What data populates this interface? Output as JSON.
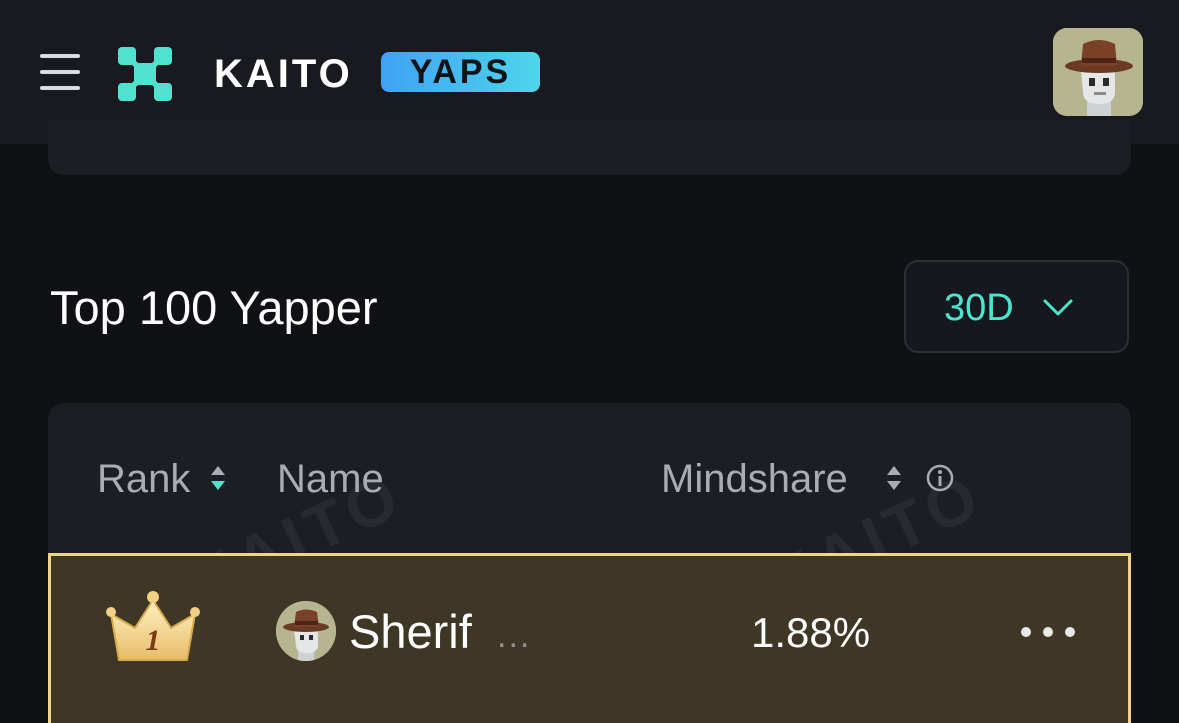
{
  "header": {
    "menu_icon": "hamburger-menu-icon",
    "logo_icon": "kaito-x-logo-icon",
    "logo_word": "KAITO",
    "logo_badge": "YAPS",
    "user_avatar": "user-avatar-hat"
  },
  "leaderboard": {
    "title": "Top 100 Yapper",
    "period_selected": "30D",
    "period_icon": "chevron-down-icon",
    "watermark_text": "KAITO",
    "columns": {
      "rank": "Rank",
      "name": "Name",
      "mindshare": "Mindshare"
    },
    "rows": [
      {
        "rank": "1",
        "rank_icon": "gold-crown-icon",
        "avatar": "avatar-hat",
        "name": "Sherif",
        "name_ellipsis": "...",
        "mindshare": "1.88%"
      }
    ]
  },
  "colors": {
    "accent": "#4fe3cf",
    "badge_gradient_start": "#3fa2f5",
    "badge_gradient_end": "#4fd6ea",
    "highlight_row_bg": "#3e3726",
    "highlight_row_border": "#f1d38a",
    "page_bg": "#0f1115",
    "card_bg": "#1c1e23"
  }
}
